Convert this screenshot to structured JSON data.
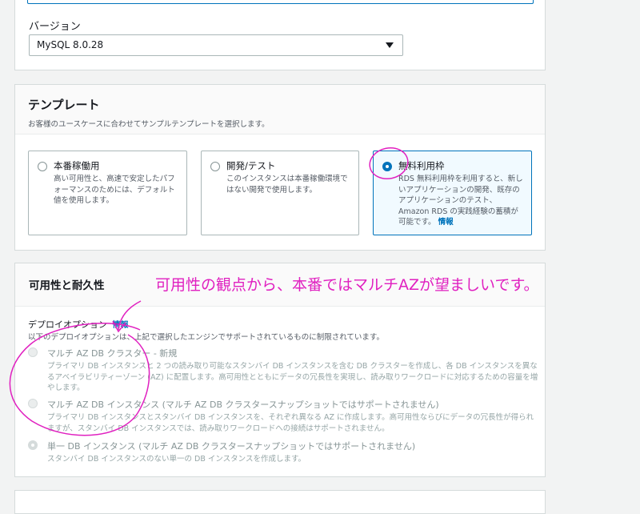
{
  "version": {
    "label": "バージョン",
    "selected": "MySQL 8.0.28"
  },
  "template": {
    "title": "テンプレート",
    "description": "お客様のユースケースに合わせてサンプルテンプレートを選択します。",
    "options": [
      {
        "label": "本番稼働用",
        "description": "高い可用性と、高速で安定したパフォーマンスのためには、デフォルト値を使用します。",
        "selected": false
      },
      {
        "label": "開発/テスト",
        "description": "このインスタンスは本番稼働環境ではない開発で使用します。",
        "selected": false
      },
      {
        "label": "無料利用枠",
        "description": "RDS 無料利用枠を利用すると、新しいアプリケーションの開発、既存のアプリケーションのテスト、Amazon RDS の実践経験の蓄積が可能です。",
        "link": "情報",
        "selected": true
      }
    ]
  },
  "availability": {
    "title": "可用性と耐久性",
    "deploy_label": "デプロイオプション",
    "deploy_info": "情報",
    "deploy_description": "以下のデプロイオプションは、上記で選択したエンジンでサポートされているものに制限されています。",
    "options": [
      {
        "title": "マルチ AZ DB クラスター - 新規",
        "description": "プライマリ DB インスタンスと 2 つの読み取り可能なスタンバイ DB インスタンスを含む DB クラスターを作成し、各 DB インスタンスを異なるアベイラビリティーゾーン (AZ) に配置します。高可用性とともにデータの冗長性を実現し、読み取りワークロードに対応するための容量を増やします。",
        "selected": false
      },
      {
        "title": "マルチ AZ DB インスタンス (マルチ AZ DB クラスタースナップショットではサポートされません)",
        "description": "プライマリ DB インスタンスとスタンバイ DB インスタンスを、それぞれ異なる AZ に作成します。高可用性ならびにデータの冗長性が得られますが、スタンバイ DB インスタンスでは、読み取りワークロードへの接続はサポートされません。",
        "selected": false
      },
      {
        "title": "単一 DB インスタンス (マルチ AZ DB クラスタースナップショットではサポートされません)",
        "description": "スタンバイ DB インスタンスのない単一の DB インスタンスを作成します。",
        "selected": true
      }
    ]
  },
  "annotation": {
    "text": "可用性の観点から、本番ではマルチAZが望ましいです。",
    "color": "#e020c0"
  },
  "colors": {
    "accent": "#0073bb",
    "annotation": "#e020c0"
  }
}
